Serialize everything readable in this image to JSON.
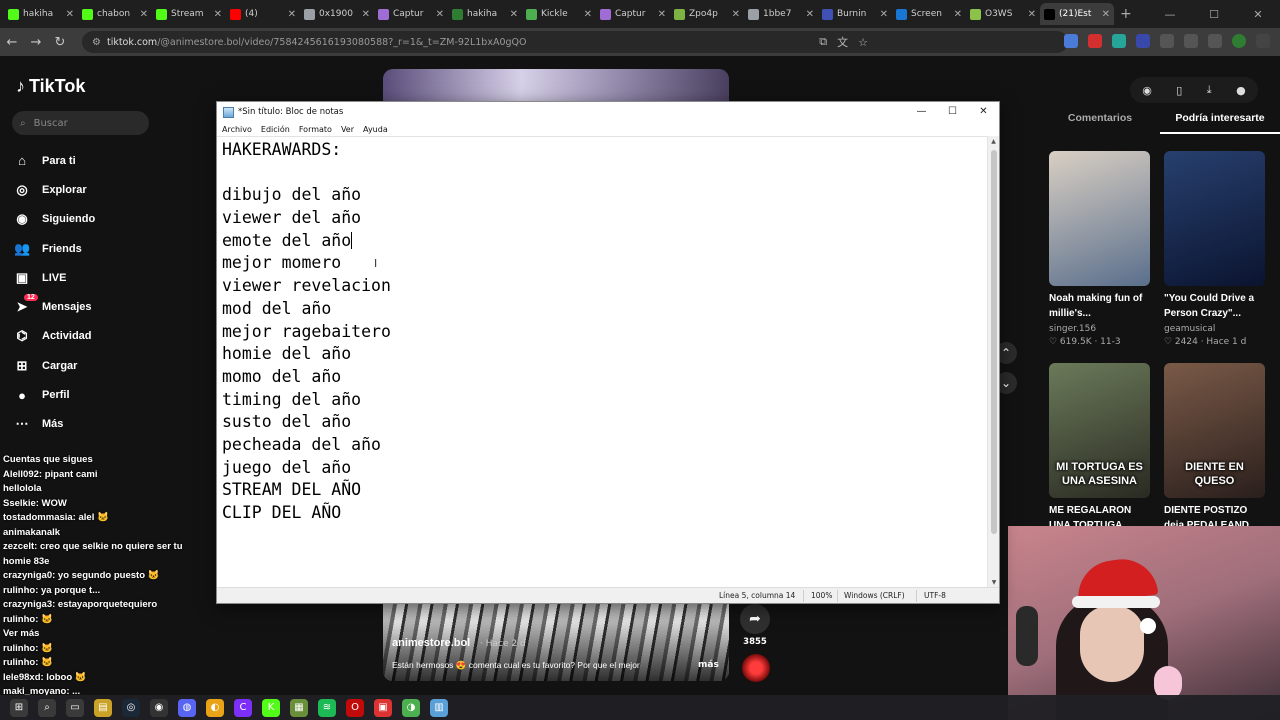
{
  "browser": {
    "tabs": [
      {
        "label": "hakiha",
        "color": "#53fc18",
        "active": false
      },
      {
        "label": "chabon",
        "color": "#53fc18",
        "active": false
      },
      {
        "label": "Stream",
        "color": "#53fc18",
        "active": false
      },
      {
        "label": "(4)",
        "color": "#ff0000",
        "active": false
      },
      {
        "label": "0x1900",
        "color": "#9aa0a6",
        "active": false
      },
      {
        "label": "Captur",
        "color": "#a06cd5",
        "active": false
      },
      {
        "label": "hakiha",
        "color": "#2e7d32",
        "active": false
      },
      {
        "label": "Kickle",
        "color": "#4caf50",
        "active": false
      },
      {
        "label": "Captur",
        "color": "#a06cd5",
        "active": false
      },
      {
        "label": "Zpo4p",
        "color": "#7cb342",
        "active": false
      },
      {
        "label": "1bbe7",
        "color": "#9aa0a6",
        "active": false
      },
      {
        "label": "Burnin",
        "color": "#3f51b5",
        "active": false
      },
      {
        "label": "Screen",
        "color": "#1976d2",
        "active": false
      },
      {
        "label": "O3WS",
        "color": "#8bc34a",
        "active": false
      },
      {
        "label": "(21)Est",
        "color": "#000000",
        "active": true
      }
    ],
    "new_tab": "+",
    "url_host": "tiktok.com",
    "url_rest": "/@animestore.bol/video/7584245616193080588?_r=1&_t=ZM-92L1bxA0gQO"
  },
  "tiktok": {
    "logo": "TikTok",
    "search_placeholder": "Buscar",
    "nav": [
      {
        "label": "Para ti",
        "icon": "home-icon",
        "glyph": "⌂"
      },
      {
        "label": "Explorar",
        "icon": "compass-icon",
        "glyph": "◎"
      },
      {
        "label": "Siguiendo",
        "icon": "following-icon",
        "glyph": "◉"
      },
      {
        "label": "Friends",
        "icon": "friends-icon",
        "glyph": "👥"
      },
      {
        "label": "LIVE",
        "icon": "live-icon",
        "glyph": "▣"
      },
      {
        "label": "Mensajes",
        "icon": "messages-icon",
        "glyph": "➤",
        "badge": "12"
      },
      {
        "label": "Actividad",
        "icon": "activity-icon",
        "glyph": "⌬"
      },
      {
        "label": "Cargar",
        "icon": "upload-icon",
        "glyph": "⊞"
      },
      {
        "label": "Perfil",
        "icon": "profile-icon",
        "glyph": "●"
      },
      {
        "label": "Más",
        "icon": "more-icon",
        "glyph": "⋯"
      }
    ],
    "right_tabs": [
      "Comentarios",
      "Podría interesarte"
    ],
    "cards": [
      {
        "title": "Noah making fun of millie's...",
        "author": "singer.156",
        "meta": "♡ 619.5K · 11-3",
        "caption": "",
        "colors": [
          "#d9cfc3",
          "#5a6f8c"
        ]
      },
      {
        "title": "\"You Could Drive a Person Crazy\"...",
        "author": "geamusical",
        "meta": "♡ 2424 · Hace 1 d",
        "caption": "",
        "colors": [
          "#27406e",
          "#0b1430"
        ]
      },
      {
        "title": "ME REGALARON UNA TORTUGA...",
        "author": "",
        "meta": "",
        "caption": "MI TORTUGA ES UNA ASESINA",
        "colors": [
          "#6b7a5a",
          "#2a2a22"
        ]
      },
      {
        "title": "DIENTE POSTIZO deja PEDALEAND...",
        "author": "",
        "meta": "",
        "caption": "DIENTE EN QUESO",
        "colors": [
          "#7a5a48",
          "#2a1f1c"
        ]
      }
    ],
    "video": {
      "author": "animestore.bol",
      "time": "· Hace 2 d",
      "description": "Están hermosos 😍 comenta cual es tu favorito? Por que el mejor",
      "more": "más",
      "shares": "3855"
    }
  },
  "chat": [
    "Cuentas que sigues",
    "Alell092: pipant cami",
    "hellolola",
    "Sselkie: WOW",
    "tostadommasia: alel 🐱",
    "animakanalk",
    "zezcelt: creo que selkie no quiere ser tu",
    "homie 83e",
    "crazyniga0: yo segundo puesto 🐱",
    "rulinho: ya porque t...",
    "crazyniga3: estayaporquetequiero",
    "rulinho: 🐱",
    "Ver más",
    "rulinho: 🐱",
    "rulinho: 🐱",
    "lele98xd: loboo 🐱",
    "maki_moyano: ..."
  ],
  "notepad": {
    "title": "*Sin título: Bloc de notas",
    "menu": [
      "Archivo",
      "Edición",
      "Formato",
      "Ver",
      "Ayuda"
    ],
    "lines": [
      "HAKERAWARDS:",
      "",
      "dibujo del año",
      "viewer del año",
      "emote del año",
      "mejor momero",
      "viewer revelacion",
      "mod del año",
      "mejor ragebaitero",
      "homie del año",
      "momo del año",
      "timing del año",
      "susto del año",
      "pecheada del año",
      "juego del año",
      "STREAM DEL AÑO",
      "CLIP DEL AÑO"
    ],
    "caret_line": 4,
    "status": {
      "position": "Línea 5, columna 14",
      "zoom": "100%",
      "line_ending": "Windows (CRLF)",
      "encoding": "UTF-8"
    }
  }
}
